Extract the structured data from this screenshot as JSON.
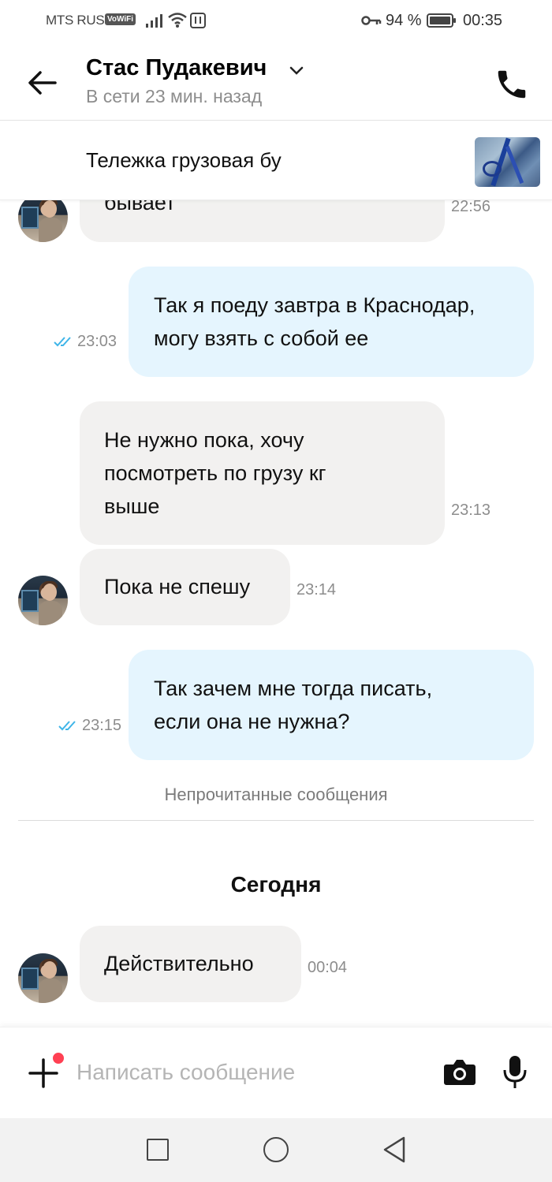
{
  "status_bar": {
    "carrier": "MTS RUS",
    "vowifi": "VoWiFi",
    "battery_percent": "94 %",
    "time": "00:35"
  },
  "header": {
    "contact_name": "Стас Пудакевич",
    "contact_status": "В сети 23 мин. назад"
  },
  "item": {
    "title": "Тележка грузовая бу"
  },
  "messages": [
    {
      "direction": "in",
      "text": "бывает",
      "time": "22:56"
    },
    {
      "direction": "out",
      "text": "Так я поеду завтра в Краснодар,\nмогу взять с собой ее",
      "time": "23:03",
      "status": "read"
    },
    {
      "direction": "in",
      "text": "Не нужно пока, хочу\nпосмотреть по грузу кг\nвыше",
      "time": "23:13"
    },
    {
      "direction": "in",
      "text": "Пока не спешу",
      "time": "23:14"
    },
    {
      "direction": "out",
      "text": "Так зачем мне тогда писать,\nесли она не нужна?",
      "time": "23:15",
      "status": "read"
    },
    {
      "direction": "in",
      "text": "Действительно",
      "time": "00:04"
    }
  ],
  "unread_label": "Непрочитанные сообщения",
  "day_label": "Сегодня",
  "composer": {
    "placeholder": "Написать сообщение"
  },
  "colors": {
    "incoming_bubble": "#f2f1f0",
    "outgoing_bubble": "#e5f5fe",
    "read_ticks": "#3fb5e8",
    "notification_dot": "#ff4053"
  }
}
